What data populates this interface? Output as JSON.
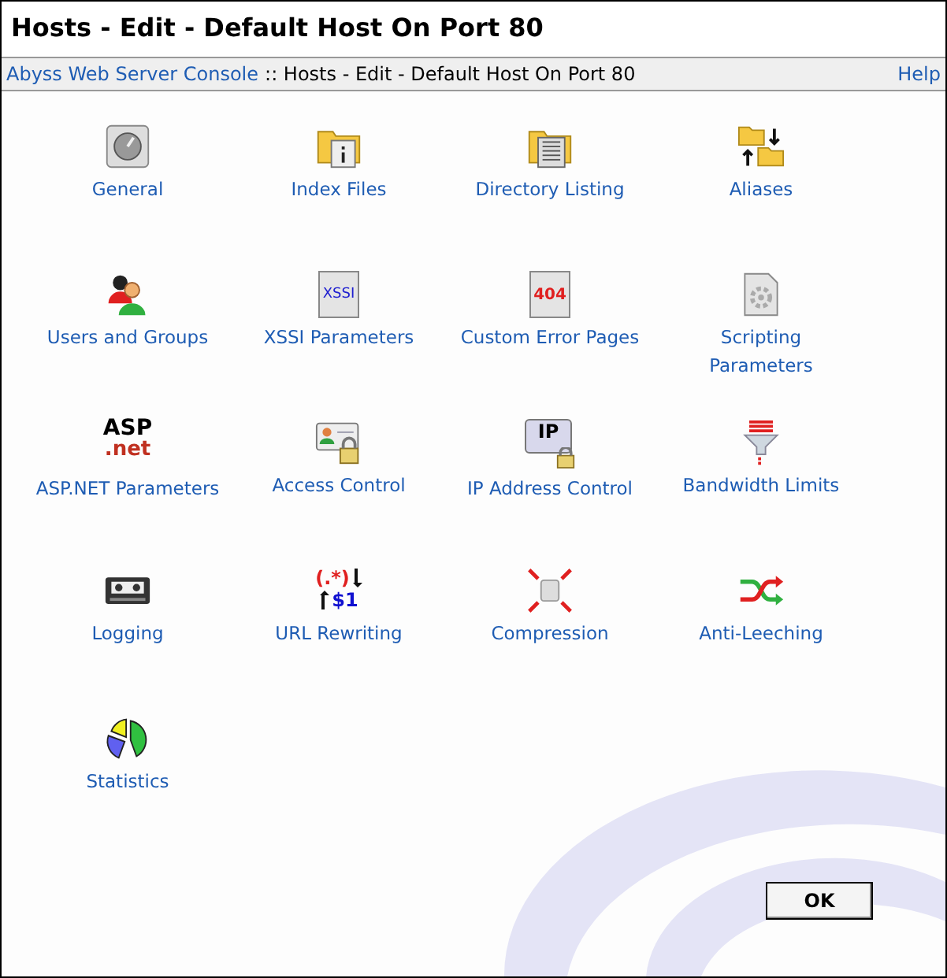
{
  "window": {
    "title": "Hosts - Edit - Default Host On Port 80"
  },
  "breadcrumb": {
    "link": "Abyss Web Server Console",
    "separator": "::",
    "current": "Hosts - Edit - Default Host On Port 80",
    "help": "Help"
  },
  "items": [
    {
      "kind": "general",
      "label": "General"
    },
    {
      "kind": "index",
      "label": "Index Files"
    },
    {
      "kind": "listing",
      "label": "Directory Listing"
    },
    {
      "kind": "aliases",
      "label": "Aliases"
    },
    {
      "kind": "users",
      "label": "Users and Groups"
    },
    {
      "kind": "xssi",
      "label": "XSSI Parameters",
      "icon_text": [
        "XSSI"
      ]
    },
    {
      "kind": "error",
      "label": "Custom Error Pages",
      "icon_text": [
        "404"
      ]
    },
    {
      "kind": "scripting",
      "label": "Scripting Parameters"
    },
    {
      "kind": "asp",
      "label": "ASP.NET Parameters",
      "icon_text": [
        "ASP",
        ".net"
      ]
    },
    {
      "kind": "access",
      "label": "Access Control"
    },
    {
      "kind": "ip",
      "label": "IP Address Control",
      "icon_text": [
        "IP"
      ]
    },
    {
      "kind": "bandwidth",
      "label": "Bandwidth Limits"
    },
    {
      "kind": "logging",
      "label": "Logging"
    },
    {
      "kind": "rewrite",
      "label": "URL Rewriting",
      "icon_text": [
        "(.*)",
        "$1"
      ]
    },
    {
      "kind": "compression",
      "label": "Compression"
    },
    {
      "kind": "leech",
      "label": "Anti-Leeching"
    },
    {
      "kind": "stats",
      "label": "Statistics"
    }
  ],
  "ok_button": "OK"
}
